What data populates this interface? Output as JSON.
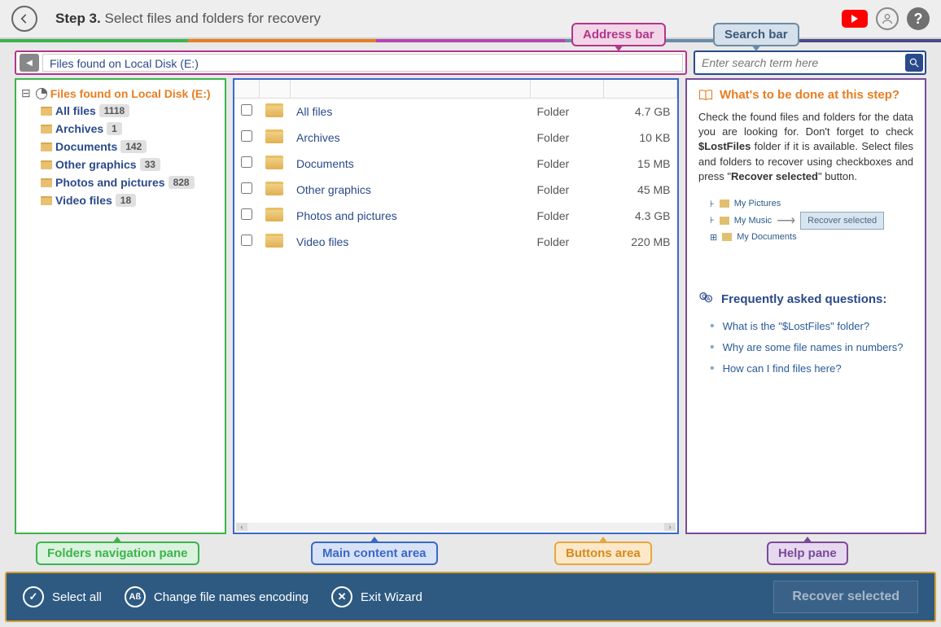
{
  "header": {
    "step_label": "Step 3.",
    "step_text": "Select files and folders for recovery"
  },
  "annotations": {
    "address": "Address bar",
    "search": "Search bar",
    "folders": "Folders navigation pane",
    "main": "Main content area",
    "buttons": "Buttons area",
    "help": "Help pane"
  },
  "address_bar": {
    "path": "Files found on Local Disk (E:)"
  },
  "search": {
    "placeholder": "Enter search term here"
  },
  "tree": {
    "root": "Files found on Local Disk (E:)",
    "items": [
      {
        "name": "All files",
        "count": "1118"
      },
      {
        "name": "Archives",
        "count": "1"
      },
      {
        "name": "Documents",
        "count": "142"
      },
      {
        "name": "Other graphics",
        "count": "33"
      },
      {
        "name": "Photos and pictures",
        "count": "828"
      },
      {
        "name": "Video files",
        "count": "18"
      }
    ]
  },
  "files": {
    "type_label": "Folder",
    "rows": [
      {
        "name": "All files",
        "size": "4.7 GB"
      },
      {
        "name": "Archives",
        "size": "10 KB"
      },
      {
        "name": "Documents",
        "size": "15 MB"
      },
      {
        "name": "Other graphics",
        "size": "45 MB"
      },
      {
        "name": "Photos and pictures",
        "size": "4.3 GB"
      },
      {
        "name": "Video files",
        "size": "220 MB"
      }
    ]
  },
  "help": {
    "title": "What's to be done at this step?",
    "body_pre": "Check the found files and folders for the data you are looking for. Don't forget to check ",
    "body_bold": "$LostFiles",
    "body_mid": " folder if it is available. Select files and folders to recover using checkboxes and press \"",
    "body_bold2": "Recover selected",
    "body_post": "\" button.",
    "illus": {
      "a": "My Pictures",
      "b": "My Music",
      "c": "My Documents",
      "btn": "Recover selected"
    },
    "faq_title": "Frequently asked questions:",
    "faq": [
      "What is the \"$LostFiles\" folder?",
      "Why are some file names in numbers?",
      "How can I find files here?"
    ]
  },
  "bottom": {
    "select_all": "Select all",
    "encoding": "Change file names encoding",
    "exit": "Exit Wizard",
    "recover": "Recover selected"
  }
}
